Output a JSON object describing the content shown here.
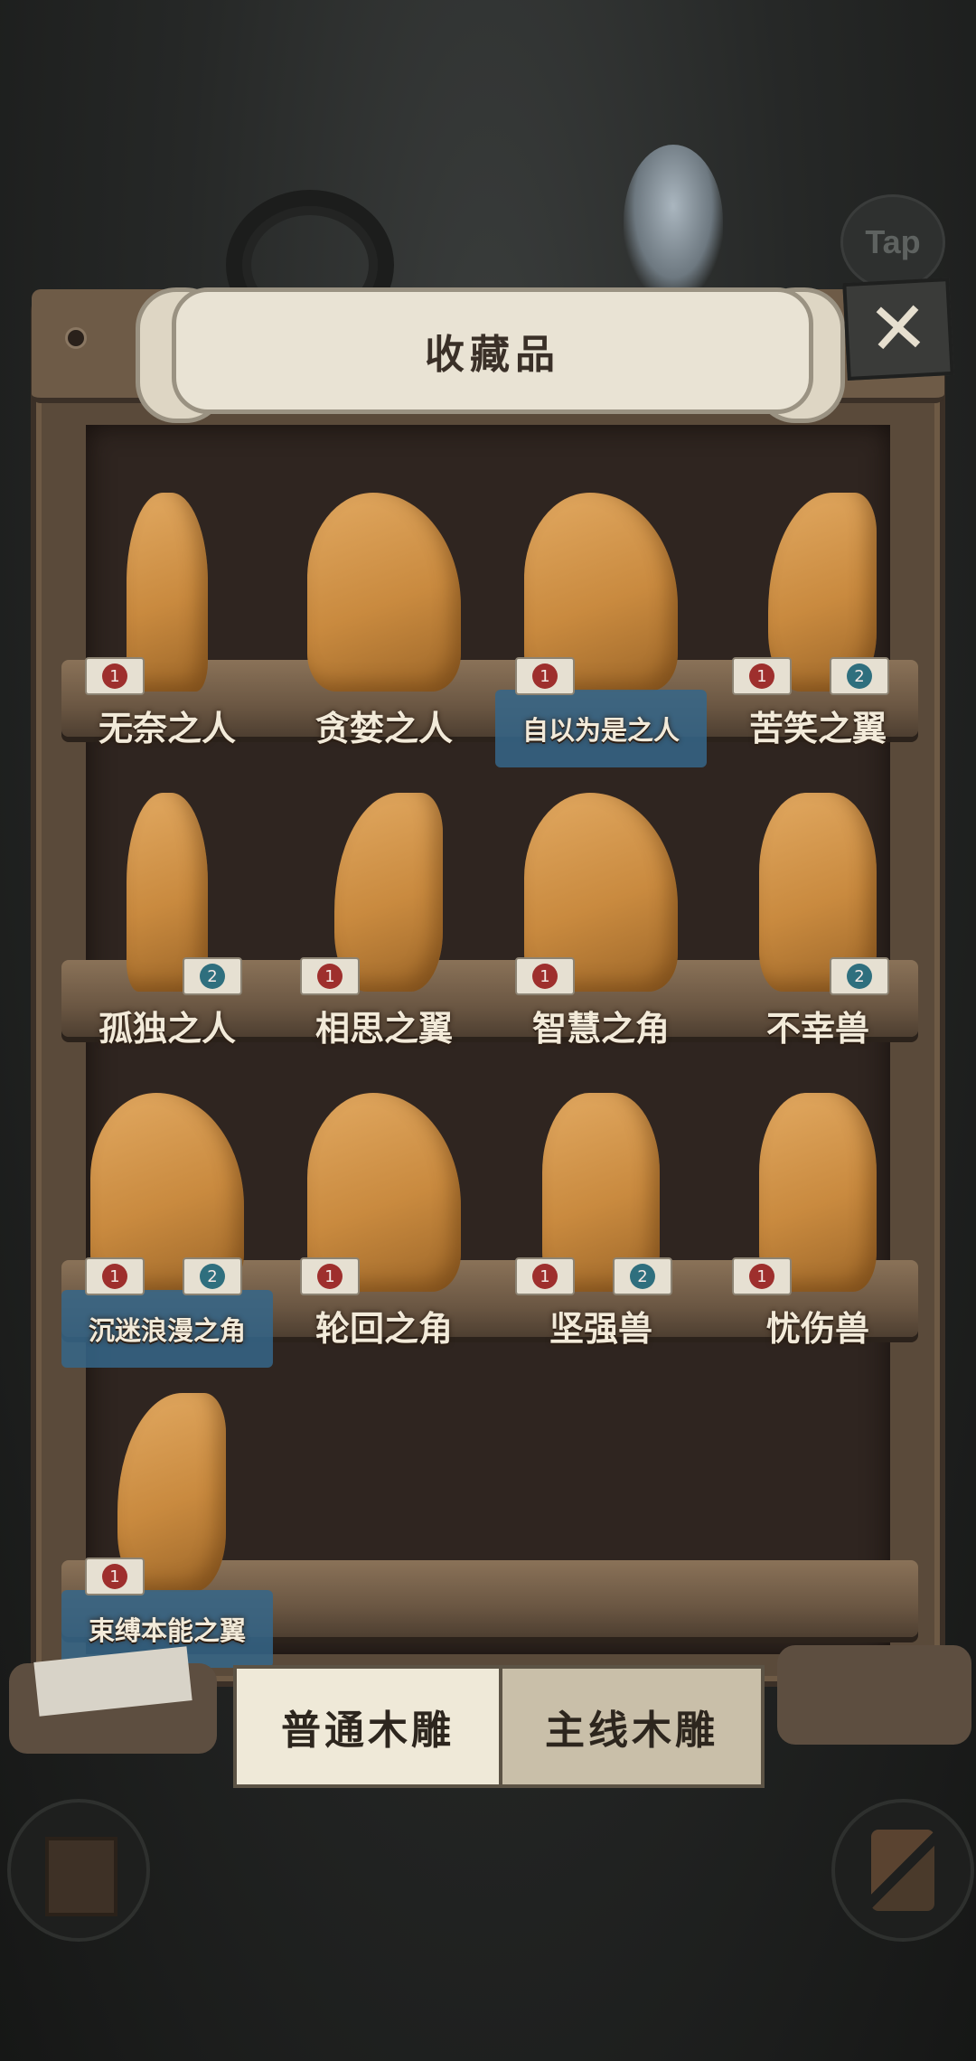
{
  "header": {
    "title": "收藏品",
    "tap_label": "Tap",
    "close_glyph": "✕"
  },
  "items": [
    {
      "name": "无奈之人",
      "badges": [
        "1"
      ],
      "blue_plaque": false
    },
    {
      "name": "贪婪之人",
      "badges": [],
      "blue_plaque": false
    },
    {
      "name": "自以为是之人",
      "badges": [
        "1"
      ],
      "blue_plaque": true
    },
    {
      "name": "苦笑之翼",
      "badges": [
        "1",
        "2"
      ],
      "blue_plaque": false
    },
    {
      "name": "孤独之人",
      "badges": [
        "2"
      ],
      "blue_plaque": false
    },
    {
      "name": "相思之翼",
      "badges": [
        "1"
      ],
      "blue_plaque": false
    },
    {
      "name": "智慧之角",
      "badges": [
        "1"
      ],
      "blue_plaque": false
    },
    {
      "name": "不幸兽",
      "badges": [
        "2"
      ],
      "blue_plaque": false
    },
    {
      "name": "沉迷浪漫之角",
      "badges": [
        "1",
        "2"
      ],
      "blue_plaque": true
    },
    {
      "name": "轮回之角",
      "badges": [
        "1"
      ],
      "blue_plaque": false
    },
    {
      "name": "坚强兽",
      "badges": [
        "1",
        "2"
      ],
      "blue_plaque": false
    },
    {
      "name": "忧伤兽",
      "badges": [
        "1"
      ],
      "blue_plaque": false
    },
    {
      "name": "束缚本能之翼",
      "badges": [
        "1"
      ],
      "blue_plaque": true
    }
  ],
  "tabs": {
    "normal": "普通木雕",
    "main": "主线木雕"
  },
  "colors": {
    "badge_red": "#9e2f2d",
    "badge_blue": "#2f6f7e",
    "plaque_blue": "#35668a"
  }
}
